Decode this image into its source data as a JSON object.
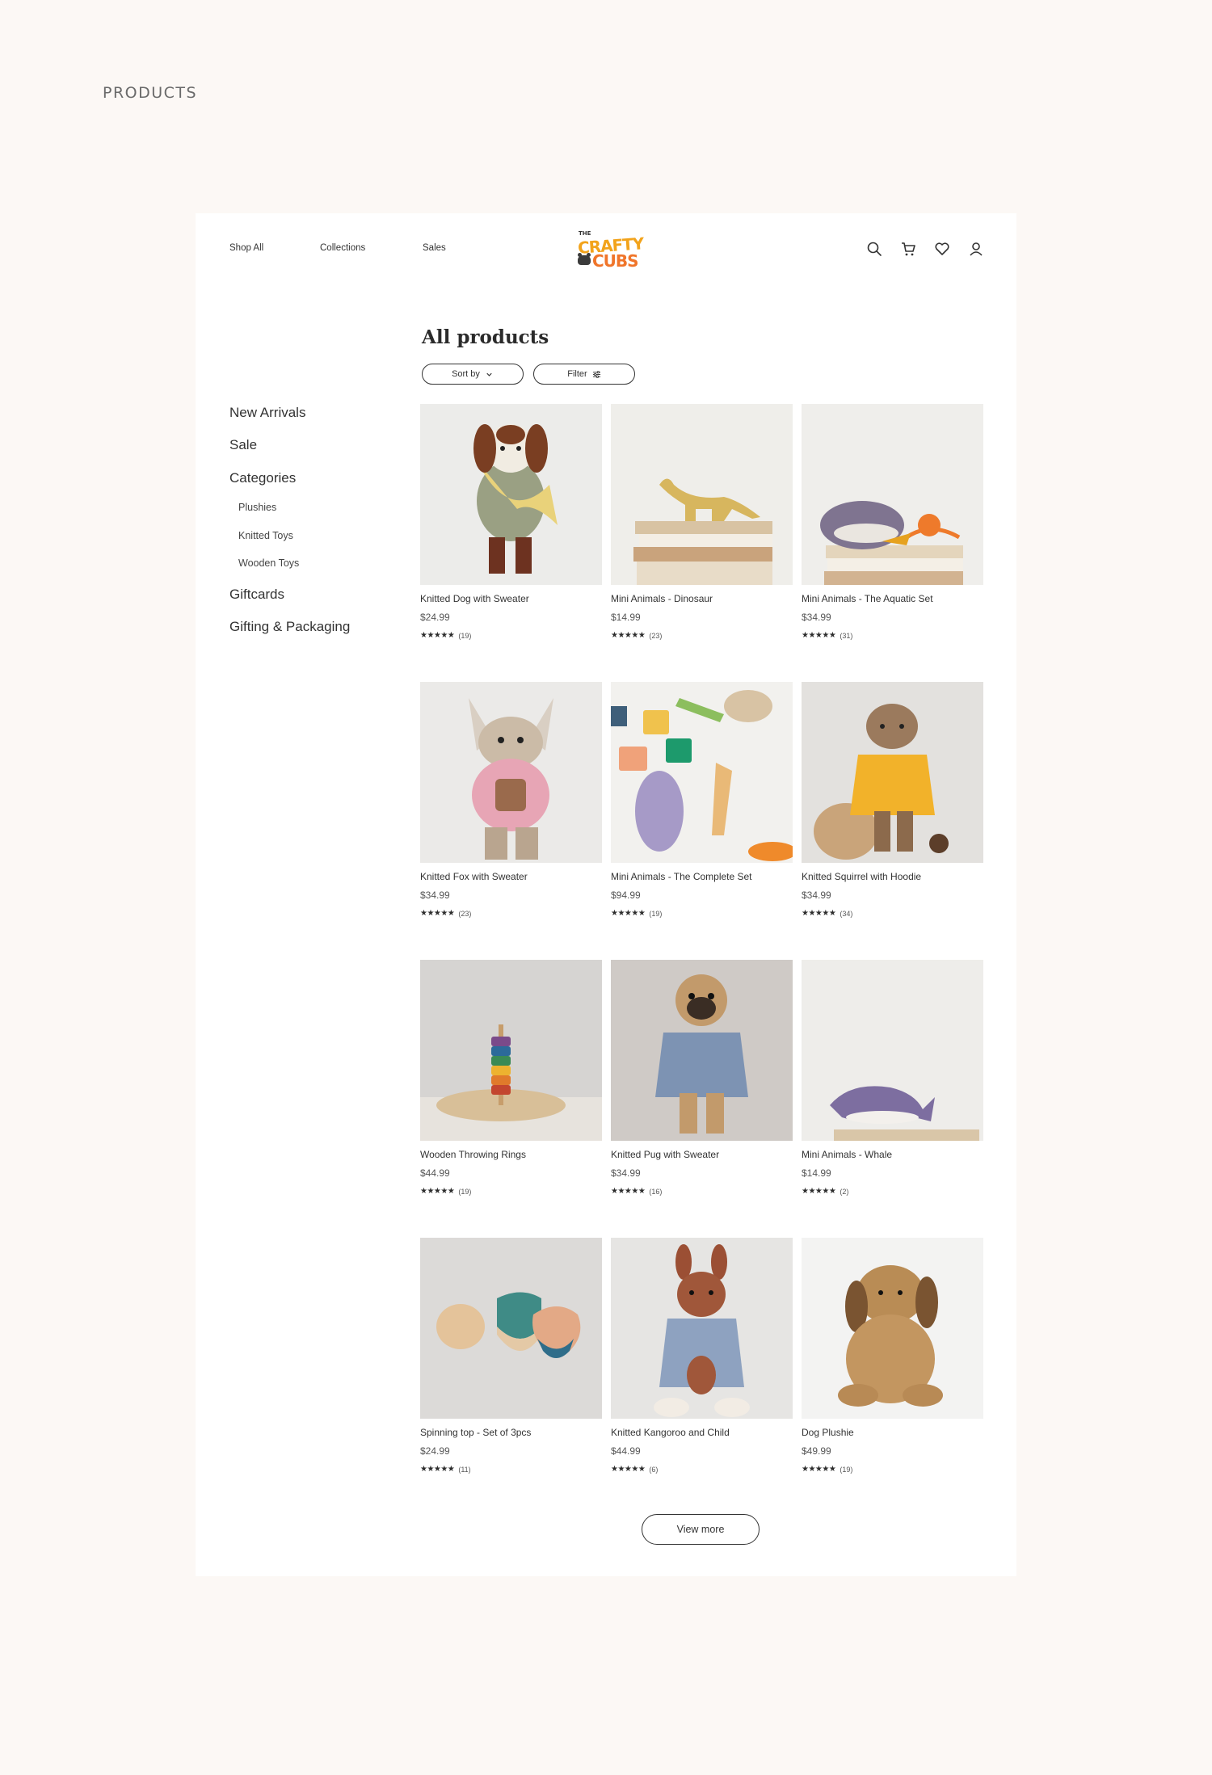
{
  "page_label": "PRODUCTS",
  "nav": {
    "links": [
      "Shop All",
      "Collections",
      "Sales"
    ],
    "logo": {
      "the": "THE",
      "line1": "CRAFTY",
      "line2": "CUBS"
    },
    "icons": [
      "search-icon",
      "cart-icon",
      "heart-icon",
      "user-icon"
    ]
  },
  "sidebar": {
    "new_arrivals": "New Arrivals",
    "sale": "Sale",
    "categories": "Categories",
    "sub": [
      "Plushies",
      "Knitted Toys",
      "Wooden Toys"
    ],
    "giftcards": "Giftcards",
    "gifting": "Gifting & Packaging"
  },
  "main": {
    "title": "All products",
    "sort_label": "Sort by",
    "filter_label": "Filter",
    "view_more": "View more"
  },
  "stars": "★★★★★",
  "products": [
    {
      "name": "Knitted Dog with Sweater",
      "price": "$24.99",
      "reviews": "(19)"
    },
    {
      "name": "Mini Animals - Dinosaur",
      "price": "$14.99",
      "reviews": "(23)"
    },
    {
      "name": "Mini Animals - The Aquatic Set",
      "price": "$34.99",
      "reviews": "(31)"
    },
    {
      "name": "Knitted Fox with Sweater",
      "price": "$34.99",
      "reviews": "(23)"
    },
    {
      "name": "Mini Animals - The Complete Set",
      "price": "$94.99",
      "reviews": "(19)"
    },
    {
      "name": "Knitted Squirrel with Hoodie",
      "price": "$34.99",
      "reviews": "(34)"
    },
    {
      "name": "Wooden Throwing Rings",
      "price": "$44.99",
      "reviews": "(19)"
    },
    {
      "name": "Knitted Pug with Sweater",
      "price": "$34.99",
      "reviews": "(16)"
    },
    {
      "name": "Mini Animals - Whale",
      "price": "$14.99",
      "reviews": "(2)"
    },
    {
      "name": "Spinning top - Set of 3pcs",
      "price": "$24.99",
      "reviews": "(11)"
    },
    {
      "name": "Knitted Kangoroo and Child",
      "price": "$44.99",
      "reviews": "(6)"
    },
    {
      "name": "Dog Plushie",
      "price": "$49.99",
      "reviews": "(19)"
    }
  ],
  "colors": {
    "background": "#fcf8f5",
    "logo_orange": "#f0752a",
    "logo_yellow": "#f2a31b"
  }
}
